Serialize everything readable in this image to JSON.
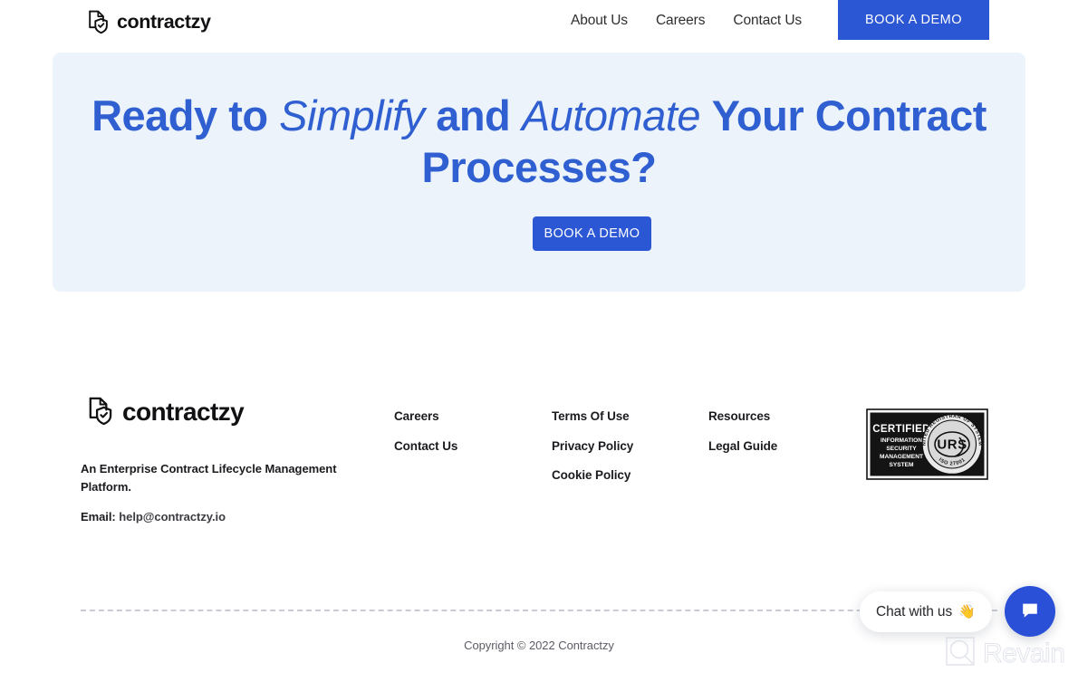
{
  "header": {
    "logo": {
      "text": "contractzy",
      "icon": "document-shield-check-icon"
    },
    "nav": [
      {
        "label": "About Us"
      },
      {
        "label": "Careers"
      },
      {
        "label": "Contact Us"
      }
    ],
    "cta_label": "BOOK A DEMO"
  },
  "hero": {
    "title_parts": [
      {
        "text": "Ready to ",
        "style": "bold"
      },
      {
        "text": "Simplify ",
        "style": "italic"
      },
      {
        "text": "and ",
        "style": "bold"
      },
      {
        "text": "Automate ",
        "style": "italic"
      },
      {
        "text": "Your Contract Processes?",
        "style": "bold"
      }
    ],
    "title_plain": "Ready to Simplify and Automate Your Contract Processes?",
    "cta_label": "BOOK A DEMO",
    "background_color": "#ecf3fb",
    "text_color": "#2f5fd0",
    "accent_color": "#2b57d4"
  },
  "footer": {
    "logo": {
      "text": "contractzy",
      "icon": "document-shield-check-icon"
    },
    "tagline": "An Enterprise Contract Lifecycle Management Platform.",
    "email_label": "Email:",
    "email_address": "help@contractzy.io",
    "columns": [
      {
        "links": [
          {
            "label": "Careers"
          },
          {
            "label": "Contact Us"
          }
        ]
      },
      {
        "links": [
          {
            "label": "Terms Of Use"
          },
          {
            "label": "Privacy Policy"
          },
          {
            "label": "Cookie Policy"
          }
        ]
      },
      {
        "links": [
          {
            "label": "Resources"
          },
          {
            "label": "Legal Guide"
          }
        ]
      }
    ],
    "certification": {
      "title": "CERTIFIED",
      "line1": "INFORMATION",
      "line2": "SECURITY",
      "line3": "MANAGEMENT",
      "line4": "SYSTEM",
      "seal_text": "URS",
      "seal_ring_top": "UNITED REGISTRAR OF SYSTEMS",
      "seal_ring_bottom": "ISO 27001"
    },
    "copyright": "Copyright © 2022 Contractzy"
  },
  "chat_widget": {
    "bubble_text": "Chat with us",
    "wave_emoji": "👋",
    "button_color": "#2b50d8",
    "icon": "chat-bubble-icon"
  },
  "watermark": {
    "text": "Revain",
    "icon": "revain-logo-icon"
  }
}
